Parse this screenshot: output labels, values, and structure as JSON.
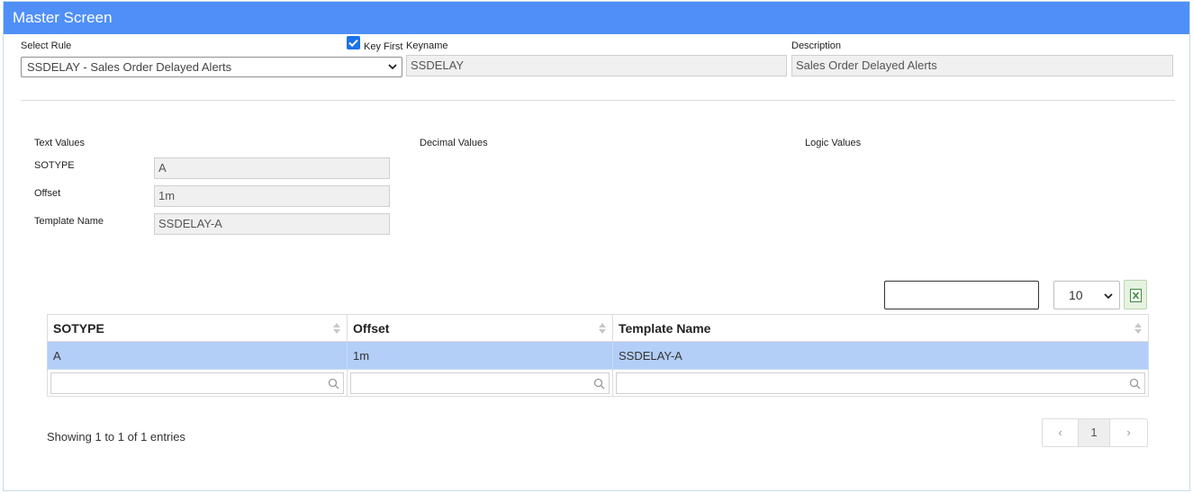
{
  "header": {
    "title": "Master Screen"
  },
  "rule": {
    "select_label": "Select Rule",
    "selected": "SSDELAY - Sales Order Delayed Alerts",
    "key_first_label": "Key First",
    "key_first_checked": true,
    "keyname_label": "Keyname",
    "keyname_value": "SSDELAY",
    "description_label": "Description",
    "description_value": "Sales Order Delayed Alerts"
  },
  "sections": {
    "text_values": "Text Values",
    "decimal_values": "Decimal Values",
    "logic_values": "Logic Values"
  },
  "text_fields": [
    {
      "label": "SOTYPE",
      "value": "A"
    },
    {
      "label": "Offset",
      "value": "1m"
    },
    {
      "label": "Template Name",
      "value": "SSDELAY-A"
    }
  ],
  "table": {
    "page_length": "10",
    "columns": [
      "SOTYPE",
      "Offset",
      "Template Name"
    ],
    "rows": [
      [
        "A",
        "1m",
        "SSDELAY-A"
      ]
    ],
    "info": "Showing 1 to 1 of 1 entries",
    "pager": {
      "prev": "‹",
      "current": "1",
      "next": "›"
    }
  },
  "colors": {
    "header_bg": "#4f8ff7",
    "selected_row": "#b3cef7",
    "checkbox": "#1a73e8"
  }
}
